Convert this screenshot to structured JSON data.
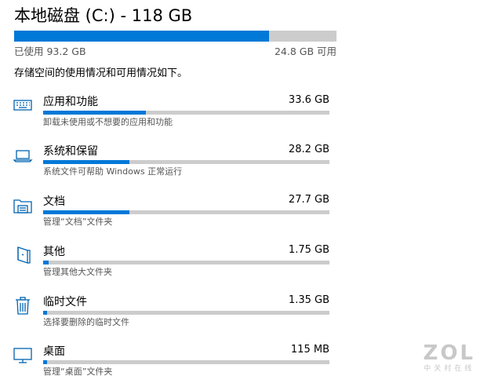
{
  "drive": {
    "title": "本地磁盘 (C:) - 118 GB",
    "used_label": "已使用 93.2 GB",
    "free_label": "24.8 GB 可用",
    "used_fraction": 0.79
  },
  "summary": "存储空间的使用情况和可用情况如下。",
  "categories": [
    {
      "name": "应用和功能",
      "size": "33.6 GB",
      "desc": "卸载未使用或不想要的应用和功能",
      "fraction": 0.36,
      "icon": "apps-icon"
    },
    {
      "name": "系统和保留",
      "size": "28.2 GB",
      "desc": "系统文件可帮助 Windows 正常运行",
      "fraction": 0.3,
      "icon": "laptop-icon"
    },
    {
      "name": "文档",
      "size": "27.7 GB",
      "desc": "管理“文档”文件夹",
      "fraction": 0.3,
      "icon": "documents-folder-icon"
    },
    {
      "name": "其他",
      "size": "1.75 GB",
      "desc": "管理其他大文件夹",
      "fraction": 0.02,
      "icon": "other-folder-icon"
    },
    {
      "name": "临时文件",
      "size": "1.35 GB",
      "desc": "选择要删除的临时文件",
      "fraction": 0.015,
      "icon": "trash-icon"
    },
    {
      "name": "桌面",
      "size": "115 MB",
      "desc": "管理“桌面”文件夹",
      "fraction": 0.003,
      "icon": "desktop-monitor-icon"
    }
  ],
  "watermark": {
    "logo": "ZOL",
    "sub": "中关村在线"
  },
  "colors": {
    "accent": "#0078d7",
    "track": "#cccccc",
    "secondary_text": "#555555"
  }
}
